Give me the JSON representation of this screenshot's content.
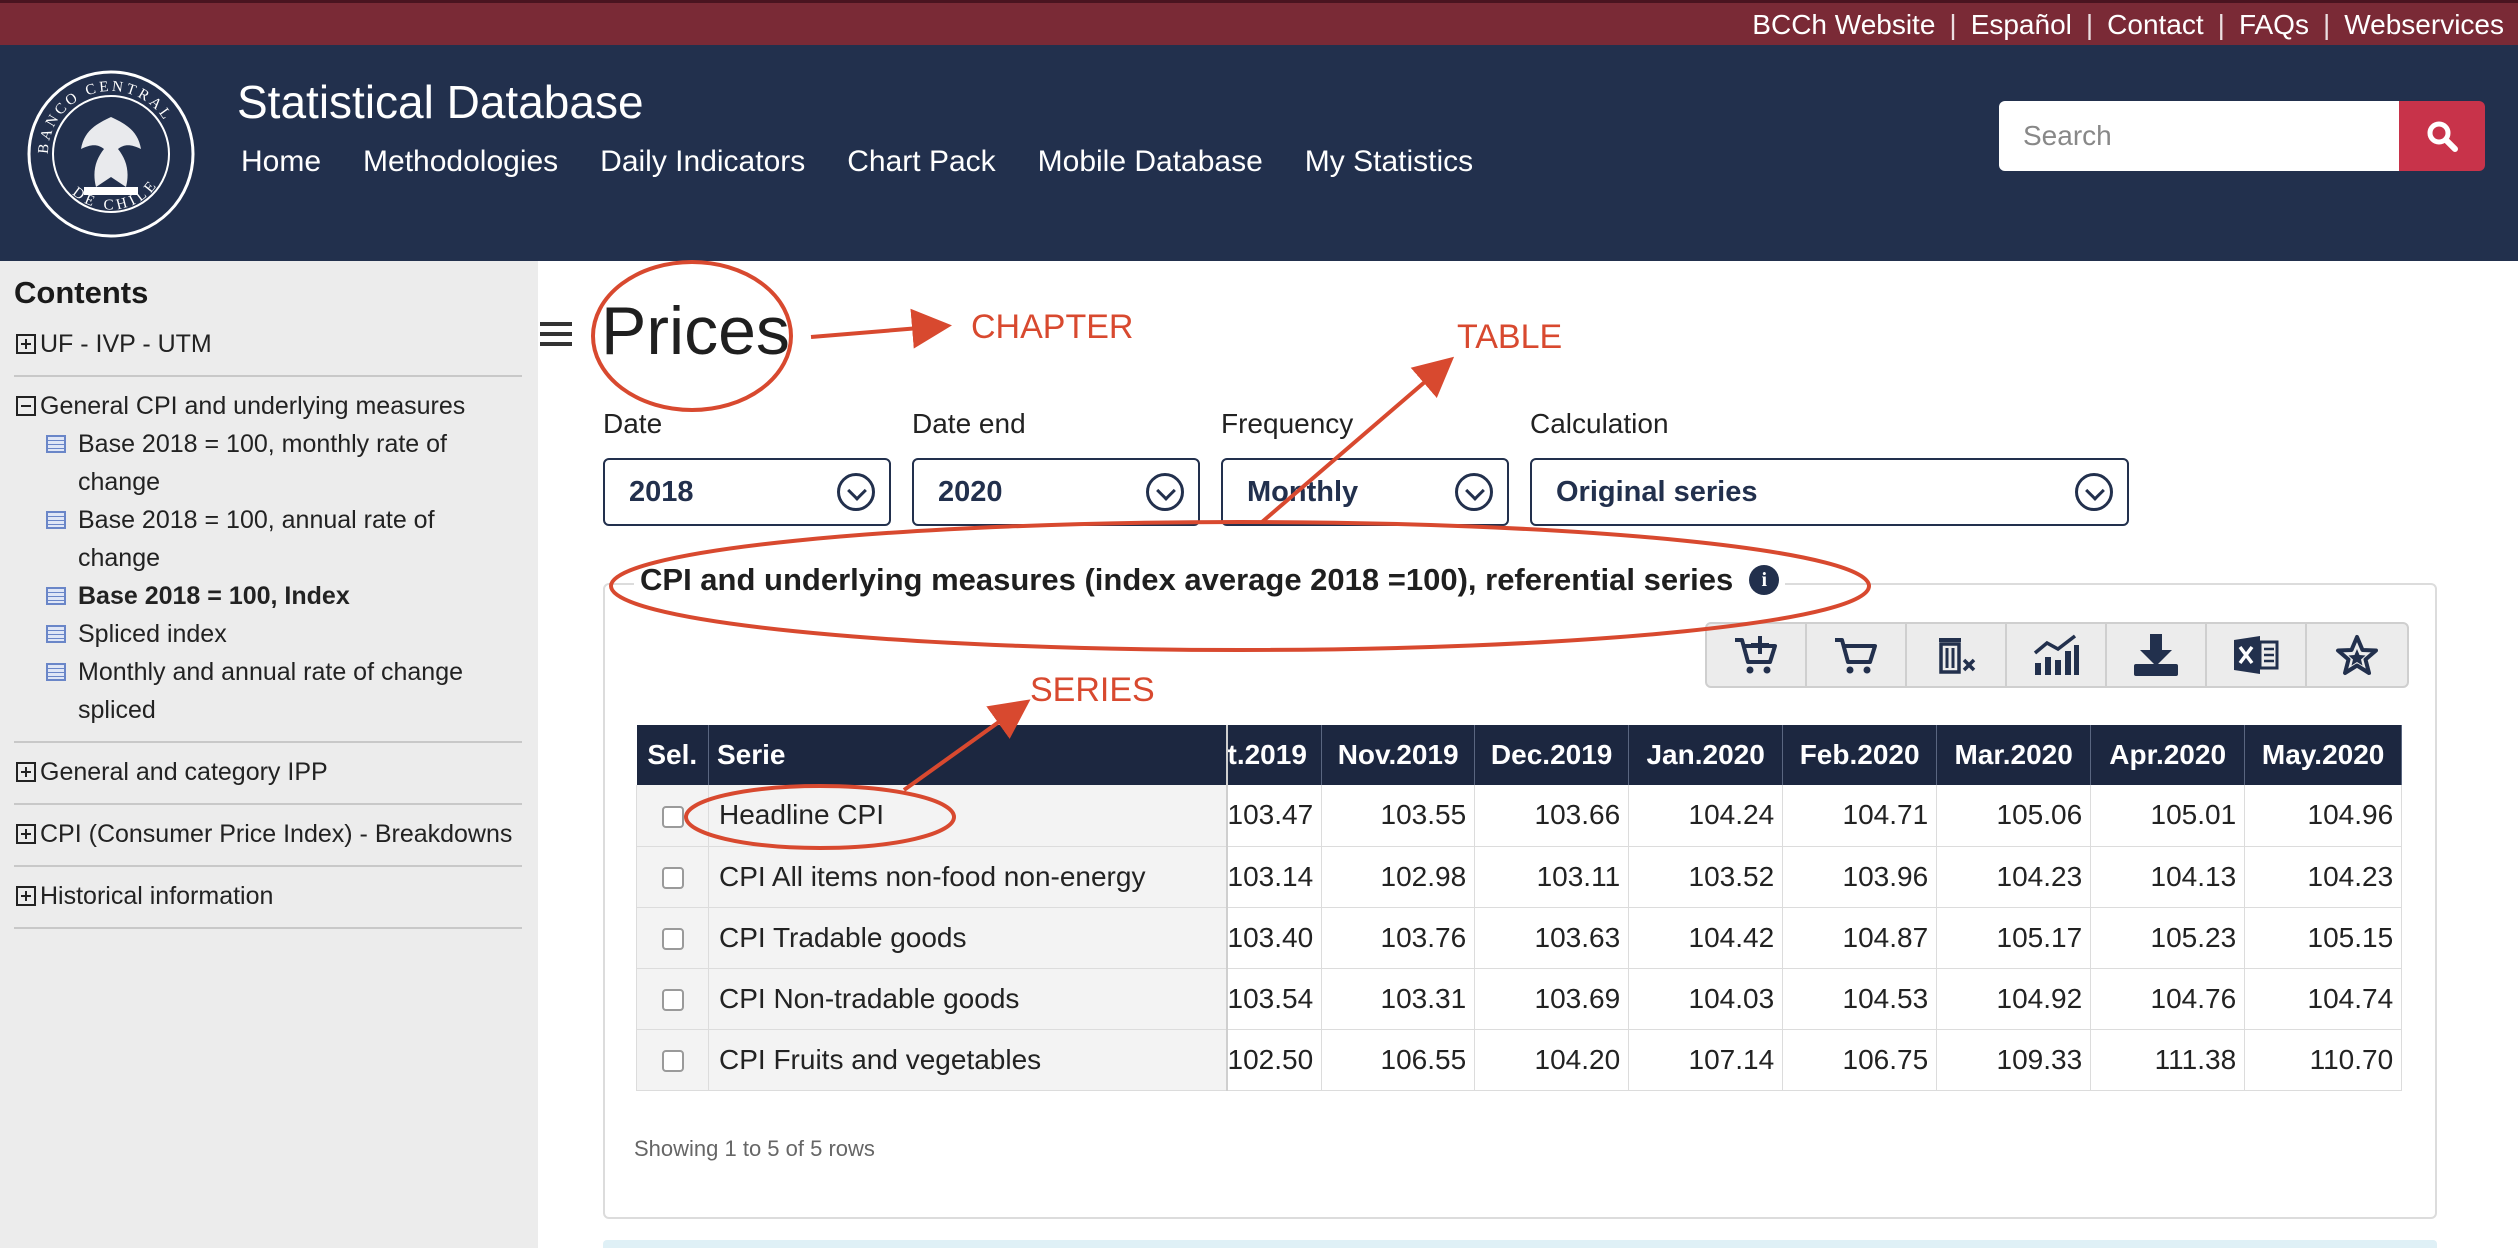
{
  "utility": {
    "links": [
      "BCCh Website",
      "Español",
      "Contact",
      "FAQs",
      "Webservices"
    ],
    "separator": "|"
  },
  "header": {
    "title": "Statistical Database",
    "nav": [
      "Home",
      "Methodologies",
      "Daily Indicators",
      "Chart Pack",
      "Mobile Database",
      "My Statistics"
    ],
    "search_placeholder": "Search",
    "logo_text_top": "BANCO CENTRAL",
    "logo_text_bottom": "DE CHILE"
  },
  "sidebar": {
    "title": "Contents",
    "groups": [
      {
        "label": "UF - IVP - UTM",
        "expanded": false
      },
      {
        "label": "General CPI and underlying measures",
        "expanded": true,
        "items": [
          {
            "label": "Base 2018 = 100, monthly rate of change",
            "active": false
          },
          {
            "label": "Base 2018 = 100, annual rate of change",
            "active": false
          },
          {
            "label": "Base 2018 = 100, Index",
            "active": true
          },
          {
            "label": "Spliced index",
            "active": false
          },
          {
            "label": "Monthly and annual rate of change spliced",
            "active": false
          }
        ]
      },
      {
        "label": "General and category IPP",
        "expanded": false
      },
      {
        "label": "CPI (Consumer Price Index) - Breakdowns",
        "expanded": false
      },
      {
        "label": "Historical information",
        "expanded": false
      }
    ]
  },
  "main": {
    "title": "Prices",
    "filters": [
      {
        "label": "Date",
        "value": "2018"
      },
      {
        "label": "Date end",
        "value": "2020"
      },
      {
        "label": "Frequency",
        "value": "Monthly"
      },
      {
        "label": "Calculation",
        "value": "Original series"
      }
    ],
    "table_title": "CPI and underlying measures (index average 2018 =100), referential series",
    "info_icon": "i",
    "toolbar": [
      "add-to-cart-icon",
      "cart-icon",
      "delete-icon",
      "chart-icon",
      "download-icon",
      "excel-icon",
      "favorite-star-icon"
    ],
    "table": {
      "col_sel": "Sel.",
      "col_serie": "Serie",
      "months": [
        "t.2019",
        "Nov.2019",
        "Dec.2019",
        "Jan.2020",
        "Feb.2020",
        "Mar.2020",
        "Apr.2020",
        "May.2020"
      ],
      "rows": [
        {
          "serie": "Headline CPI",
          "values": [
            "103.47",
            "103.55",
            "103.66",
            "104.24",
            "104.71",
            "105.06",
            "105.01",
            "104.96"
          ]
        },
        {
          "serie": "CPI All items non-food non-energy",
          "values": [
            "103.14",
            "102.98",
            "103.11",
            "103.52",
            "103.96",
            "104.23",
            "104.13",
            "104.23"
          ]
        },
        {
          "serie": "CPI Tradable goods",
          "values": [
            "103.40",
            "103.76",
            "103.63",
            "104.42",
            "104.87",
            "105.17",
            "105.23",
            "105.15"
          ]
        },
        {
          "serie": "CPI Non-tradable goods",
          "values": [
            "103.54",
            "103.31",
            "103.69",
            "104.03",
            "104.53",
            "104.92",
            "104.76",
            "104.74"
          ]
        },
        {
          "serie": "CPI Fruits and vegetables",
          "values": [
            "102.50",
            "106.55",
            "104.20",
            "107.14",
            "106.75",
            "109.33",
            "111.38",
            "110.70"
          ]
        }
      ]
    },
    "footer": "Showing 1 to 5 of 5 rows"
  },
  "annotations": {
    "chapter": "CHAPTER",
    "table": "TABLE",
    "series": "SERIES",
    "color": "#d8492f"
  },
  "colors": {
    "utility_bar": "#7a2a36",
    "header": "#22304d",
    "search_button": "#c8334a",
    "table_header": "#1c2740",
    "sidebar": "#ececec"
  }
}
